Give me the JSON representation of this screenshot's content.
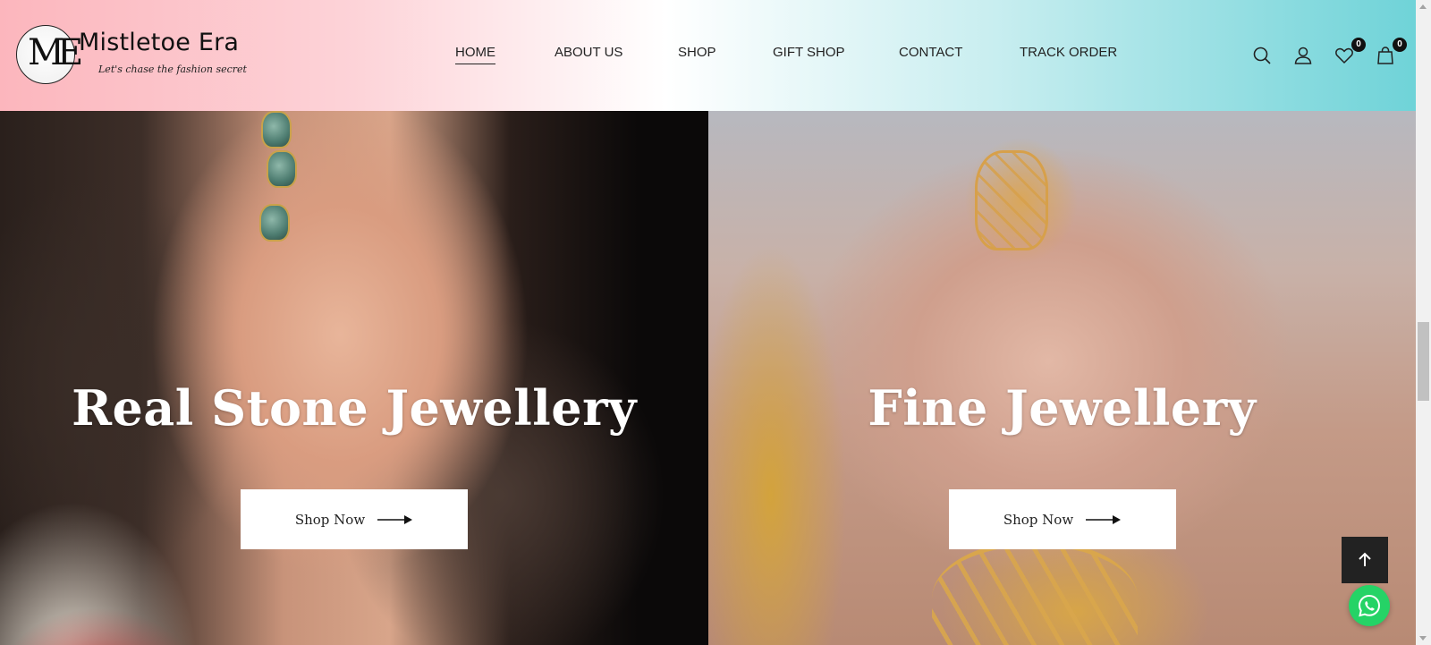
{
  "header": {
    "logo": {
      "monogram": "ME",
      "title": "Mistletoe Era",
      "tagline": "Let's chase the fashion secret"
    },
    "nav": [
      {
        "label": "HOME",
        "active": true
      },
      {
        "label": "ABOUT US",
        "active": false
      },
      {
        "label": "SHOP",
        "active": false
      },
      {
        "label": "GIFT SHOP",
        "active": false
      },
      {
        "label": "CONTACT",
        "active": false
      },
      {
        "label": "TRACK ORDER",
        "active": false
      }
    ],
    "icons": {
      "search": "search-icon",
      "account": "user-icon",
      "wishlist": "heart-icon",
      "cart": "bag-icon"
    },
    "wishlist_count": "0",
    "cart_count": "0"
  },
  "banners": [
    {
      "title": "Real Stone Jewellery",
      "button_label": "Shop Now"
    },
    {
      "title": "Fine Jewellery",
      "button_label": "Shop Now"
    }
  ],
  "floating": {
    "back_to_top_icon": "arrow-up-icon",
    "whatsapp_icon": "whatsapp-icon",
    "whatsapp_color": "#25D366"
  },
  "colors": {
    "header_gradient_left": "#FCB6BD",
    "header_gradient_right": "#6FD3D8",
    "text_dark": "#222222"
  }
}
